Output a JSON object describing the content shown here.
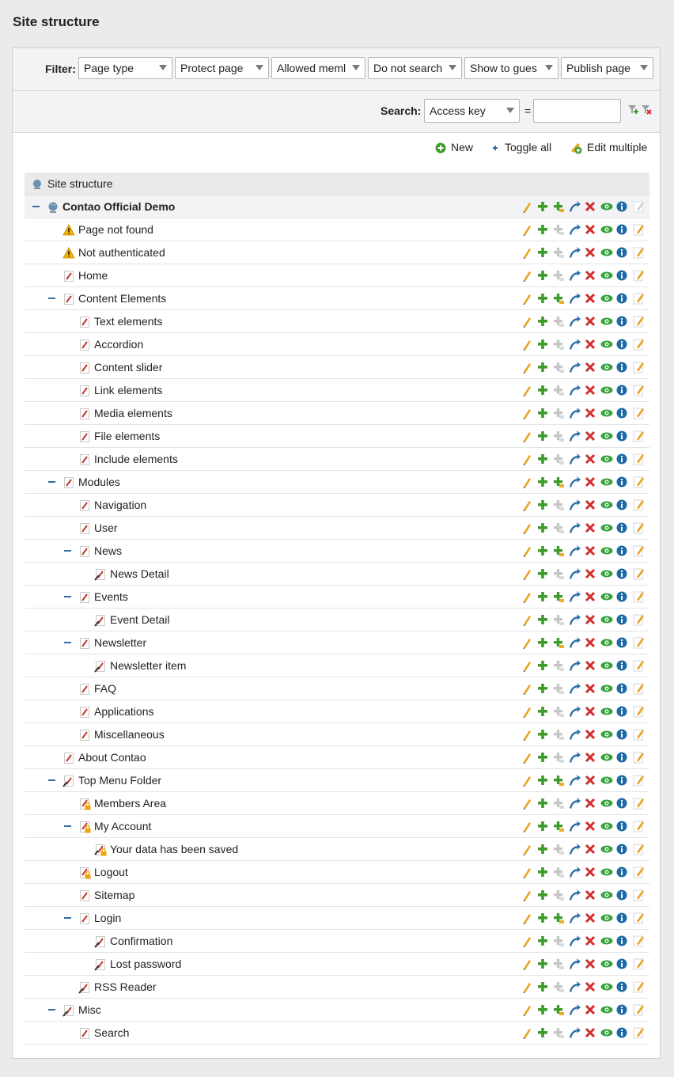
{
  "page": {
    "title": "Site structure"
  },
  "filter": {
    "label": "Filter:",
    "selects": [
      {
        "value": "Page type"
      },
      {
        "value": "Protect page"
      },
      {
        "value": "Allowed meml"
      },
      {
        "value": "Do not search"
      },
      {
        "value": "Show to gues"
      },
      {
        "value": "Publish page"
      }
    ]
  },
  "search": {
    "label": "Search:",
    "field": "Access key",
    "equals": "=",
    "value": ""
  },
  "actions": {
    "new": "New",
    "toggle_all": "Toggle all",
    "edit_multiple": "Edit multiple"
  },
  "tree": {
    "header": "Site structure",
    "rows": [
      {
        "label": "Contao Official Demo",
        "level": 0,
        "icon": "globe-icon",
        "toggle": true,
        "root": true
      },
      {
        "label": "Page not found",
        "level": 1,
        "icon": "warning-icon",
        "toggle": false
      },
      {
        "label": "Not authenticated",
        "level": 1,
        "icon": "warning-icon",
        "toggle": false
      },
      {
        "label": "Home",
        "level": 1,
        "icon": "page-icon",
        "toggle": false
      },
      {
        "label": "Content Elements",
        "level": 1,
        "icon": "page-icon",
        "toggle": true
      },
      {
        "label": "Text elements",
        "level": 2,
        "icon": "page-icon",
        "toggle": false
      },
      {
        "label": "Accordion",
        "level": 2,
        "icon": "page-icon",
        "toggle": false
      },
      {
        "label": "Content slider",
        "level": 2,
        "icon": "page-icon",
        "toggle": false
      },
      {
        "label": "Link elements",
        "level": 2,
        "icon": "page-icon",
        "toggle": false
      },
      {
        "label": "Media elements",
        "level": 2,
        "icon": "page-icon",
        "toggle": false
      },
      {
        "label": "File elements",
        "level": 2,
        "icon": "page-icon",
        "toggle": false
      },
      {
        "label": "Include elements",
        "level": 2,
        "icon": "page-icon",
        "toggle": false
      },
      {
        "label": "Modules",
        "level": 1,
        "icon": "page-icon",
        "toggle": true
      },
      {
        "label": "Navigation",
        "level": 2,
        "icon": "page-icon",
        "toggle": false
      },
      {
        "label": "User",
        "level": 2,
        "icon": "page-icon",
        "toggle": false
      },
      {
        "label": "News",
        "level": 2,
        "icon": "page-icon",
        "toggle": true
      },
      {
        "label": "News Detail",
        "level": 3,
        "icon": "hidden-page-icon",
        "toggle": false
      },
      {
        "label": "Events",
        "level": 2,
        "icon": "page-icon",
        "toggle": true
      },
      {
        "label": "Event Detail",
        "level": 3,
        "icon": "hidden-page-icon",
        "toggle": false
      },
      {
        "label": "Newsletter",
        "level": 2,
        "icon": "page-icon",
        "toggle": true
      },
      {
        "label": "Newsletter item",
        "level": 3,
        "icon": "hidden-page-icon",
        "toggle": false
      },
      {
        "label": "FAQ",
        "level": 2,
        "icon": "page-icon",
        "toggle": false
      },
      {
        "label": "Applications",
        "level": 2,
        "icon": "page-icon",
        "toggle": false
      },
      {
        "label": "Miscellaneous",
        "level": 2,
        "icon": "page-icon",
        "toggle": false
      },
      {
        "label": "About Contao",
        "level": 1,
        "icon": "page-icon",
        "toggle": false
      },
      {
        "label": "Top Menu Folder",
        "level": 1,
        "icon": "hidden-page-icon",
        "toggle": true
      },
      {
        "label": "Members Area",
        "level": 2,
        "icon": "protected-page-icon",
        "toggle": false
      },
      {
        "label": "My Account",
        "level": 2,
        "icon": "protected-page-icon",
        "toggle": true
      },
      {
        "label": "Your data has been saved",
        "level": 3,
        "icon": "protected-hidden-page-icon",
        "toggle": false
      },
      {
        "label": "Logout",
        "level": 2,
        "icon": "protected-page-icon",
        "toggle": false
      },
      {
        "label": "Sitemap",
        "level": 2,
        "icon": "page-icon",
        "toggle": false
      },
      {
        "label": "Login",
        "level": 2,
        "icon": "page-icon",
        "toggle": true
      },
      {
        "label": "Confirmation",
        "level": 3,
        "icon": "hidden-page-icon",
        "toggle": false
      },
      {
        "label": "Lost password",
        "level": 3,
        "icon": "hidden-page-icon",
        "toggle": false
      },
      {
        "label": "RSS Reader",
        "level": 2,
        "icon": "hidden-page-icon",
        "toggle": false
      },
      {
        "label": "Misc",
        "level": 1,
        "icon": "hidden-page-icon",
        "toggle": true
      },
      {
        "label": "Search",
        "level": 2,
        "icon": "page-icon",
        "toggle": false
      }
    ]
  },
  "row_operations": [
    "edit",
    "paste-after",
    "paste-into",
    "move",
    "delete",
    "toggle-visibility",
    "info",
    "edit-header"
  ],
  "colors": {
    "pencil": "#e8a21c",
    "plus": "#3f9b2c",
    "delete": "#d22d2d",
    "eye": "#35a23a",
    "info": "#1f6aa5",
    "move": "#2a6ea8"
  }
}
